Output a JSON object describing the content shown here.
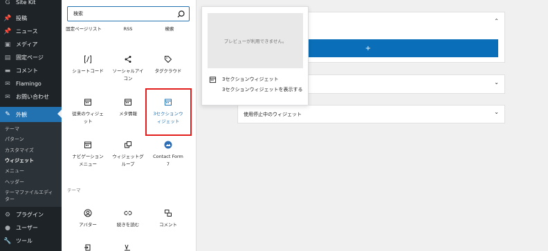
{
  "sidebar": {
    "top_item": "Site Kit",
    "items": [
      {
        "label": "投稿",
        "icon": "pin-icon"
      },
      {
        "label": "ニュース",
        "icon": "pin-icon"
      },
      {
        "label": "メディア",
        "icon": "media-icon"
      },
      {
        "label": "固定ページ",
        "icon": "page-icon"
      },
      {
        "label": "コメント",
        "icon": "comment-icon"
      },
      {
        "label": "Flamingo",
        "icon": "mail-icon"
      },
      {
        "label": "お問い合わせ",
        "icon": "mail-icon"
      },
      {
        "label": "外観",
        "icon": "brush-icon"
      }
    ],
    "submenu": [
      "テーマ",
      "パターン",
      "カスタマイズ",
      "ウィジェット",
      "メニュー",
      "ヘッダー",
      "テーマファイルエディ",
      "ター"
    ],
    "bottom_items": [
      {
        "label": "プラグイン",
        "icon": "plugin-icon"
      },
      {
        "label": "ユーザー",
        "icon": "user-icon"
      },
      {
        "label": "ツール",
        "icon": "wrench-icon"
      }
    ]
  },
  "inserter": {
    "search_value": "検索",
    "top_row": [
      "固定ページリスト",
      "RSS",
      "検索"
    ],
    "blocks": [
      {
        "label1": "ショートコード",
        "label2": "",
        "icon": "shortcode-icon"
      },
      {
        "label1": "ソーシャルアイ",
        "label2": "コン",
        "icon": "share-icon"
      },
      {
        "label1": "タグクラウド",
        "label2": "",
        "icon": "tag-icon"
      },
      {
        "label1": "従来のウィジェ",
        "label2": "ット",
        "icon": "calendar-icon"
      },
      {
        "label1": "メタ情報",
        "label2": "",
        "icon": "calendar-icon"
      },
      {
        "label1": "3セクションウ",
        "label2": "ィジェット",
        "icon": "calendar-icon"
      },
      {
        "label1": "ナビゲーション",
        "label2": "メニュー",
        "icon": "calendar-icon"
      },
      {
        "label1": "ウィジェットグ",
        "label2": "ループ",
        "icon": "group-icon"
      },
      {
        "label1": "Contact Form",
        "label2": "7",
        "icon": "contact-form-icon"
      }
    ],
    "theme_label": "テーマ",
    "theme_blocks": [
      {
        "label1": "アバター",
        "icon": "avatar-icon"
      },
      {
        "label1": "続きを読む",
        "icon": "link-icon"
      },
      {
        "label1": "コメント",
        "icon": "comments-icon"
      }
    ]
  },
  "preview": {
    "unavailable": "プレビューが利用できません。",
    "title": "3セクションウィジェット",
    "description": "3セクションウィジェットを表示する"
  },
  "main": {
    "add_symbol": "+",
    "inactive_title": "使用停止中のウィジェット"
  },
  "colors": {
    "accent": "#2271b1",
    "highlight": "#e21b1b",
    "admin_bg": "#1d2327"
  }
}
